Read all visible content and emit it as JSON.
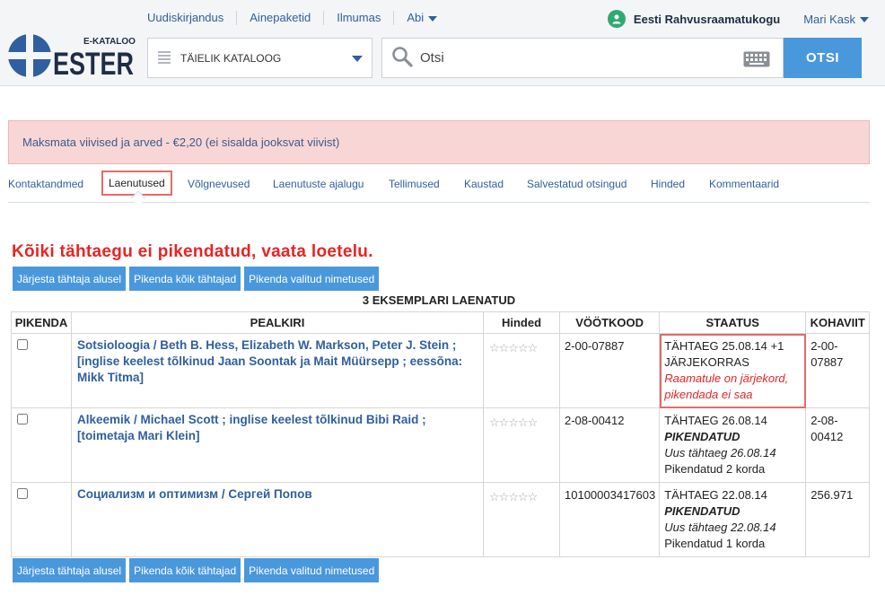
{
  "topnav": {
    "items": [
      "Uudiskirjandus",
      "Ainepaketid",
      "Ilmumas",
      "Abi"
    ]
  },
  "user": {
    "library": "Eesti Rahvusraamatukogu",
    "name": "Mari Kask"
  },
  "logo": {
    "main": "ESTER",
    "sub": "E-KATALOOG"
  },
  "search": {
    "catalog": "TÄIELIK KATALOOG",
    "placeholder": "Otsi",
    "button": "OTSI"
  },
  "alert": "Maksmata viivised ja arved - €2,20 (ei sisalda jooksvat viivist)",
  "tabs": [
    "Kontaktandmed",
    "Laenutused",
    "Võlgnevused",
    "Laenutuste ajalugu",
    "Tellimused",
    "Kaustad",
    "Salvestatud otsingud",
    "Hinded",
    "Kommentaarid"
  ],
  "active_tab": "Laenutused",
  "warning": "Kõiki tähtaegu ei pikendatud, vaata loetelu.",
  "actions": [
    "Järjesta tähtaja alusel",
    "Pikenda kõik tähtajad",
    "Pikenda valitud nimetused"
  ],
  "count_label": "3 EKSEMPLARI LAENATUD",
  "columns": [
    "PIKENDA",
    "PEALKIRI",
    "Hinded",
    "VÖÖTKOOD",
    "STAATUS",
    "KOHAVIIT"
  ],
  "stars": "☆☆☆☆☆",
  "rows": [
    {
      "title": "Sotsioloogia / Beth B. Hess, Elizabeth W. Markson, Peter J. Stein ; [inglise keelest tõlkinud Jaan Soontak ja Mait Müürsepp ; eessõna: Mikk Titma]",
      "barcode": "2-00-07887",
      "status_line1": "TÄHTAEG 25.08.14 +1",
      "status_line2": "JÄRJEKORRAS",
      "status_line3": "Raamatule on järjekord, pikendada ei saa",
      "location": "2-00-07887"
    },
    {
      "title": "Alkeemik / Michael Scott ; inglise keelest tõlkinud Bibi Raid ; [toimetaja Mari Klein]",
      "barcode": "2-08-00412",
      "status_line1": "TÄHTAEG 26.08.14",
      "status_line2": "PIKENDATUD",
      "status_line3": "Uus tähtaeg 26.08.14",
      "status_line4": "Pikendatud 2 korda",
      "location": "2-08-00412"
    },
    {
      "title": "Социализм и оптимизм / Сергей Попов",
      "barcode": "10100003417603",
      "status_line1": "TÄHTAEG 22.08.14",
      "status_line2": "PIKENDATUD",
      "status_line3": "Uus tähtaeg 22.08.14",
      "status_line4": "Pikendatud 1 korda",
      "location": "256.971"
    }
  ],
  "colors": {
    "accent": "#4a98dc",
    "link": "#2f5f9e",
    "warning": "#e82424",
    "alert_bg": "#f9d6d6",
    "highlight": "#e26b6b"
  }
}
